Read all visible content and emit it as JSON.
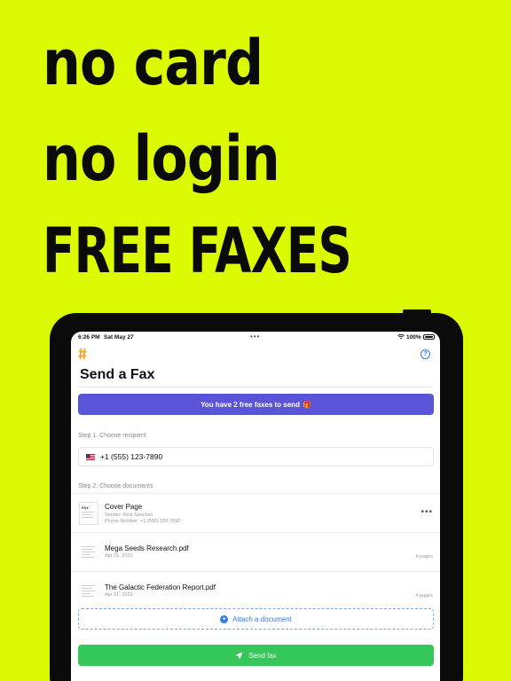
{
  "promo": {
    "line1": "no card",
    "line2": "no login",
    "line3": "FREE FAXES"
  },
  "status_bar": {
    "time": "6:26 PM",
    "date": "Sat May 27",
    "battery": "100%"
  },
  "app": {
    "title": "Send a Fax",
    "free_banner": "You have 2 free faxes to send",
    "step1_label": "Step 1. Choose recipient",
    "recipient_number": "+1 (555) 123-7890",
    "step2_label": "Step 2. Choose documents",
    "documents": [
      {
        "name": "Cover Page",
        "sender": "Sender: Rick Sanchez",
        "phone": "Phone Number: +1 (555) 123-7890"
      },
      {
        "name": "Mega Seeds Research.pdf",
        "date": "Apr 21, 2023",
        "pages": "4 pages"
      },
      {
        "name": "The Galactic Federation Report.pdf",
        "date": "Apr 21, 2023",
        "pages": "4 pages"
      }
    ],
    "attach_label": "Attach a document",
    "send_label": "Send fax"
  },
  "colors": {
    "background": "#dcfb02",
    "banner": "#5a55d8",
    "send_button": "#34c759",
    "accent_blue": "#2f7df6",
    "logo_orange": "#f5a623"
  },
  "icons": [
    "hash-logo-icon",
    "help-icon",
    "gift-icon",
    "us-flag-icon",
    "more-icon",
    "document-icon",
    "plus-icon",
    "send-icon",
    "wifi-icon",
    "battery-icon"
  ]
}
